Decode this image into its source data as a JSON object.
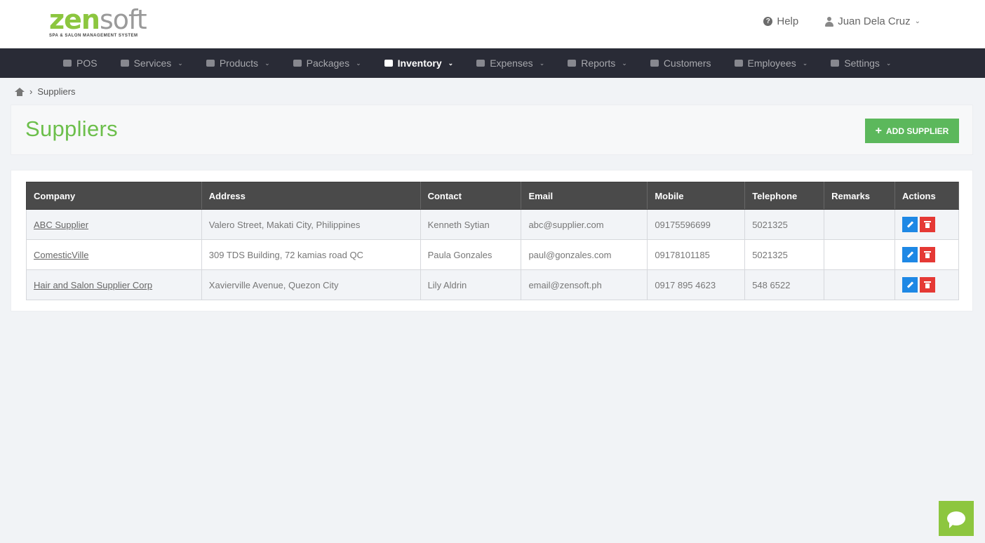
{
  "header": {
    "logo": {
      "zen": "zen",
      "soft": "soft",
      "tagline": "SPA & SALON MANAGEMENT SYSTEM"
    },
    "help_label": "Help",
    "user_name": "Juan Dela Cruz"
  },
  "nav": {
    "items": [
      {
        "label": "POS",
        "icon": "calculator-icon",
        "has_caret": false
      },
      {
        "label": "Services",
        "icon": "hand-icon",
        "has_caret": true
      },
      {
        "label": "Products",
        "icon": "cart-icon",
        "has_caret": true
      },
      {
        "label": "Packages",
        "icon": "tags-icon",
        "has_caret": true
      },
      {
        "label": "Inventory",
        "icon": "list-icon",
        "has_caret": true,
        "active": true
      },
      {
        "label": "Expenses",
        "icon": "edit-square-icon",
        "has_caret": true
      },
      {
        "label": "Reports",
        "icon": "bar-chart-icon",
        "has_caret": true
      },
      {
        "label": "Customers",
        "icon": "users-icon",
        "has_caret": false
      },
      {
        "label": "Employees",
        "icon": "briefcase-icon",
        "has_caret": true
      },
      {
        "label": "Settings",
        "icon": "gear-icon",
        "has_caret": true
      }
    ]
  },
  "breadcrumb": {
    "current": "Suppliers"
  },
  "page": {
    "title": "Suppliers",
    "add_button": "ADD SUPPLIER"
  },
  "table": {
    "headers": [
      "Company",
      "Address",
      "Contact",
      "Email",
      "Mobile",
      "Telephone",
      "Remarks",
      "Actions"
    ],
    "rows": [
      {
        "company": "ABC Supplier",
        "address": "Valero Street, Makati City, Philippines",
        "contact": "Kenneth Sytian",
        "email": "abc@supplier.com",
        "mobile": "09175596699",
        "telephone": "5021325",
        "remarks": ""
      },
      {
        "company": "ComesticVille",
        "address": "309 TDS Building, 72 kamias road QC",
        "contact": "Paula Gonzales",
        "email": "paul@gonzales.com",
        "mobile": "09178101185",
        "telephone": "5021325",
        "remarks": ""
      },
      {
        "company": "Hair and Salon Supplier Corp",
        "address": "Xavierville Avenue, Quezon City",
        "contact": "Lily Aldrin",
        "email": "email@zensoft.ph",
        "mobile": "0917 895 4623",
        "telephone": "548 6522",
        "remarks": ""
      }
    ]
  },
  "colors": {
    "accent_green": "#8cc63f",
    "title_green": "#6cbf4b",
    "button_green": "#5cb85c",
    "nav_bg": "#292b36",
    "table_header_bg": "#4a4a4a",
    "edit_blue": "#1e88e5",
    "delete_red": "#e53935"
  }
}
